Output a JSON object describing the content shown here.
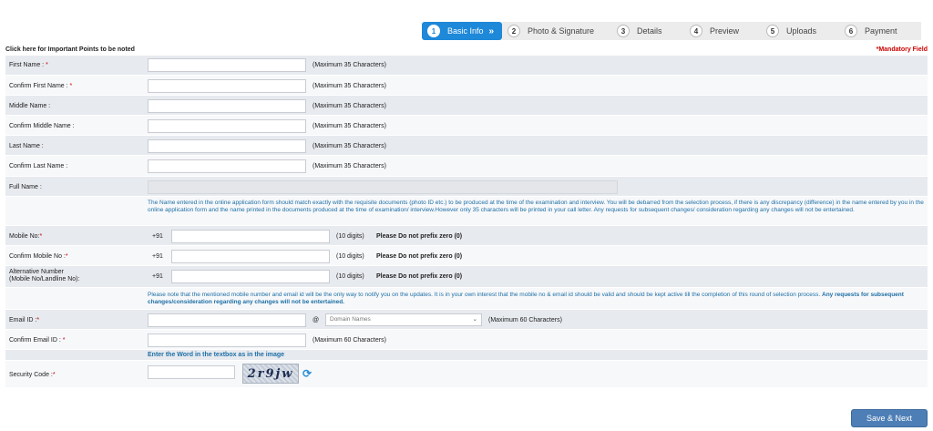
{
  "steps": [
    {
      "num": "1",
      "label": "Basic Info",
      "arrow": "»"
    },
    {
      "num": "2",
      "label": "Photo & Signature"
    },
    {
      "num": "3",
      "label": "Details"
    },
    {
      "num": "4",
      "label": "Preview"
    },
    {
      "num": "5",
      "label": "Uploads"
    },
    {
      "num": "6",
      "label": "Payment"
    }
  ],
  "header": {
    "important_link": "Click here for Important Points to be noted",
    "mandatory": "*Mandatory Field"
  },
  "form": {
    "first_name": {
      "label": "First Name :",
      "req": "*",
      "hint": "(Maximum 35 Characters)"
    },
    "confirm_first_name": {
      "label": "Confirm First Name :",
      "req": "*",
      "hint": "(Maximum 35 Characters)"
    },
    "middle_name": {
      "label": "Middle Name :",
      "hint": "(Maximum 35 Characters)"
    },
    "confirm_middle_name": {
      "label": "Confirm Middle Name :",
      "hint": "(Maximum 35 Characters)"
    },
    "last_name": {
      "label": "Last Name :",
      "hint": "(Maximum 35 Characters)"
    },
    "confirm_last_name": {
      "label": "Confirm Last Name :",
      "hint": "(Maximum 35 Characters)"
    },
    "full_name": {
      "label": "Full Name :"
    },
    "name_note": "The Name entered in the online application form should match exactly with the requisite documents (photo ID etc.) to be produced at the time of the examination and interview. You will be debarred from the selection process, if there is any discrepancy (difference) in the name entered by you in the online application form and the name printed in the documents produced at the time of examination/ interview.However only 35 characters will be printed in your call letter. Any requests for subsequent changes/ consideration regarding any changes will not be entertained.",
    "mobile": {
      "label": "Mobile No:",
      "req": "*",
      "prefix": "+91",
      "hint": "(10 digits)",
      "warn": "Please Do not prefix zero (0)"
    },
    "confirm_mobile": {
      "label": "Confirm Mobile No :",
      "req": "*",
      "prefix": "+91",
      "hint": "(10 digits)",
      "warn": "Please Do not prefix zero (0)"
    },
    "alt_number": {
      "label_line1": "Alternative Number",
      "label_line2": "(Mobile No/Landline No):",
      "prefix": "+91",
      "hint": "(10 digits)",
      "warn": "Please Do not prefix zero (0)"
    },
    "contact_note": "Please note that the mentioned mobile number and email id will be the only way to notify you on the updates. It is in your own interest that the mobile no & email id should be valid and should be kept active till the completion of this round of selection process.",
    "contact_note_bold": "Any requests for subsequent changes/consideration regarding any changes will not be entertained.",
    "email": {
      "label": "Email ID :",
      "req": "*",
      "at": "@",
      "domain_placeholder": "Domain Names",
      "hint": "(Maximum 60 Characters)"
    },
    "confirm_email": {
      "label": "Confirm Email ID :",
      "req": "*",
      "hint": "(Maximum 60 Characters)"
    },
    "enter_word": "Enter the Word in the textbox as in the image",
    "security": {
      "label": "Security Code :",
      "req": "*",
      "captcha": "2r9jw"
    }
  },
  "actions": {
    "save_next": "Save & Next"
  }
}
